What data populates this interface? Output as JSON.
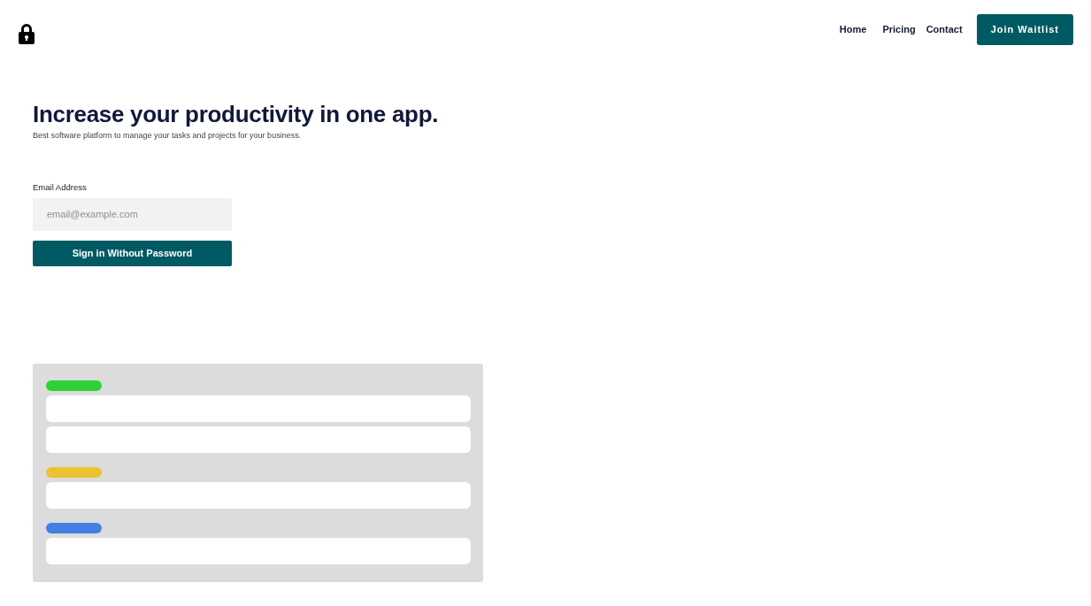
{
  "nav": {
    "links": [
      {
        "label": "Home"
      },
      {
        "label": "Pricing"
      },
      {
        "label": "Contact"
      }
    ],
    "cta": "Join Waitlist"
  },
  "hero": {
    "title": "Increase your productivity in one app.",
    "subtitle": "Best software platform to manage your tasks and projects for your business."
  },
  "form": {
    "label": "Email Address",
    "placeholder": "email@example.com",
    "submit": "Sign in Without Password"
  },
  "board": {
    "groups": [
      {
        "color": "#2ed135",
        "cards": [
          {
            "kind": "blank"
          },
          {
            "kind": "blank"
          }
        ]
      },
      {
        "color": "#ecc232",
        "cards": [
          {
            "kind": "blank"
          }
        ]
      },
      {
        "color": "#4480e4",
        "cards": [
          {
            "kind": "blank"
          }
        ]
      }
    ]
  }
}
